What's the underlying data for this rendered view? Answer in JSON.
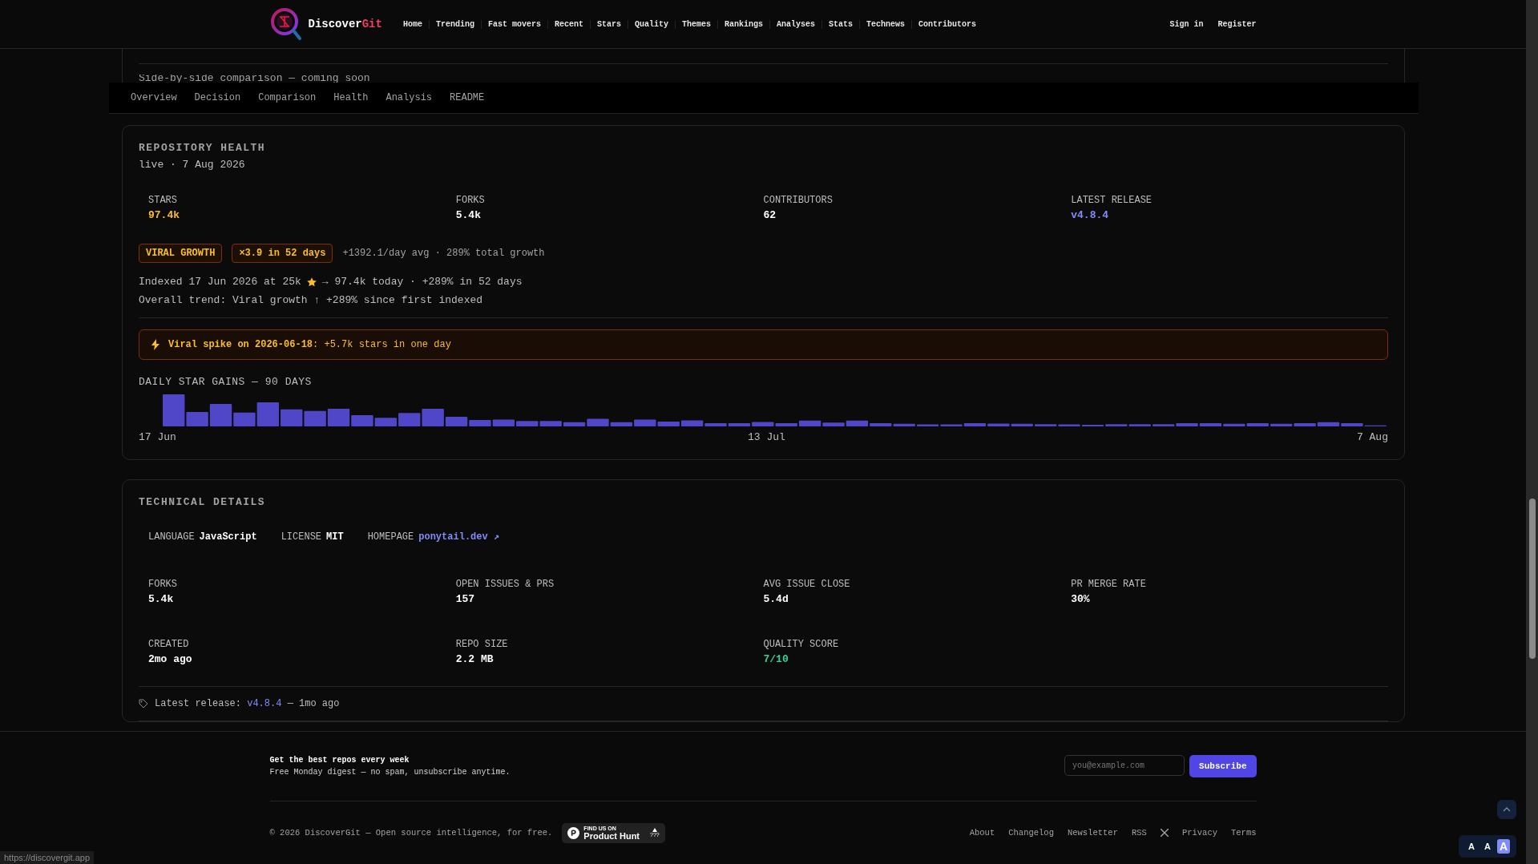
{
  "header": {
    "brand": "Discover",
    "brand_accent": "Git",
    "nav": [
      "Home",
      "Trending",
      "Fast movers",
      "Recent",
      "Stars",
      "Quality",
      "Themes",
      "Rankings",
      "Analyses",
      "Stats",
      "Technews",
      "Contributors"
    ],
    "auth": [
      "Sign in",
      "Register"
    ]
  },
  "comparison_note": "Side-by-side comparison — coming soon",
  "tabs": [
    "Overview",
    "Decision",
    "Comparison",
    "Health",
    "Analysis",
    "README"
  ],
  "health": {
    "title": "REPOSITORY HEALTH",
    "subtitle": "live · 7 Aug 2026",
    "stats": [
      {
        "label": "STARS",
        "value": "97.4k",
        "kind": "stars"
      },
      {
        "label": "FORKS",
        "value": "5.4k",
        "kind": "number"
      },
      {
        "label": "CONTRIBUTORS",
        "value": "62",
        "kind": "number"
      },
      {
        "label": "LATEST RELEASE",
        "value": "v4.8.4",
        "kind": "link"
      }
    ],
    "badges": [
      "VIRAL GROWTH",
      "×3.9 in 52 days"
    ],
    "growth_note": "+1392.1/day avg · 289% total growth",
    "indexed_before": "Indexed 17 Jun 2026 at 25k",
    "indexed_after": "→ 97.4k today · +289% in 52 days",
    "trend": "Overall trend: Viral growth ↑ +289% since first indexed",
    "spike": "**Viral spike on 2026-06-18**: +5.7k stars in one day",
    "chart_title": "DAILY STAR GAINS — 90 DAYS",
    "chart_labels": [
      "17 Jun",
      "13 Jul",
      "7 Aug"
    ]
  },
  "tech": {
    "title": "TECHNICAL DETAILS",
    "meta": [
      {
        "label": "LANGUAGE",
        "value": "JavaScript",
        "kind": "text"
      },
      {
        "label": "LICENSE",
        "value": "MIT",
        "kind": "text"
      },
      {
        "label": "HOMEPAGE",
        "value": "ponytail.dev ↗",
        "kind": "link"
      }
    ],
    "stats": [
      {
        "label": "FORKS",
        "value": "5.4k",
        "kind": "number"
      },
      {
        "label": "OPEN ISSUES & PRS",
        "value": "157",
        "kind": "number"
      },
      {
        "label": "AVG ISSUE CLOSE",
        "value": "5.4d",
        "kind": "number"
      },
      {
        "label": "PR MERGE RATE",
        "value": "30%",
        "kind": "number"
      },
      {
        "label": "CREATED",
        "value": "2mo ago",
        "kind": "number"
      },
      {
        "label": "REPO SIZE",
        "value": "2.2 MB",
        "kind": "number"
      },
      {
        "label": "QUALITY SCORE",
        "value": "7/10",
        "kind": "score"
      }
    ],
    "release_prefix": "Latest release:",
    "release_version": "v4.8.4",
    "release_suffix": "— 1mo ago"
  },
  "footer": {
    "newsletter_title": "Get the best repos every week",
    "newsletter_text": "Free Monday digest — no spam, unsubscribe anytime.",
    "email_placeholder": "you@example.com",
    "subscribe": "Subscribe",
    "copyright": "© 2026 DiscoverGit — Open source intelligence, for free.",
    "product_hunt": {
      "small": "FIND US ON",
      "big": "Product Hunt",
      "count": "???"
    },
    "links": [
      "About",
      "Changelog",
      "Newsletter",
      "RSS",
      "Privacy",
      "Terms"
    ]
  },
  "font_sizes": [
    {
      "label": "A",
      "selected": false
    },
    {
      "label": "A",
      "selected": false
    },
    {
      "label": "A",
      "selected": true
    }
  ],
  "status_url": "https://discovergit.app"
}
